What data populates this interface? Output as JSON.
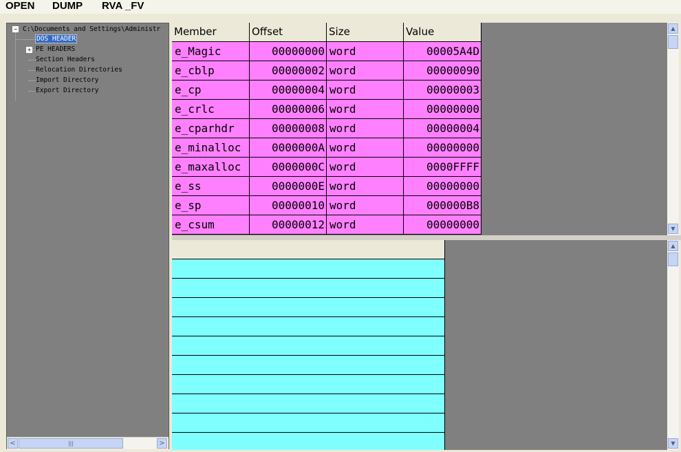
{
  "menu": [
    "OPEN",
    "DUMP",
    "RVA _FV"
  ],
  "tree": {
    "root": "C:\\Documents and Settings\\Administr",
    "root_expander": "−",
    "items": [
      {
        "label": "DOS HEADER",
        "selected": true,
        "expander": ""
      },
      {
        "label": "PE HEADERS",
        "selected": false,
        "expander": "+"
      },
      {
        "label": "Section Headers",
        "selected": false,
        "expander": ""
      },
      {
        "label": "Relocation Directories",
        "selected": false,
        "expander": ""
      },
      {
        "label": "Import Directory",
        "selected": false,
        "expander": ""
      },
      {
        "label": "Export Directory",
        "selected": false,
        "expander": ""
      }
    ]
  },
  "scroll_glyphs": {
    "left": "<",
    "right": ">",
    "up": "▲",
    "down": "▼",
    "grip": "|||"
  },
  "dos_table": {
    "columns": [
      "Member",
      "Offset",
      "Size",
      "Value"
    ],
    "rows": [
      [
        "e_Magic",
        "00000000",
        "word",
        "00005A4D"
      ],
      [
        "e_cblp",
        "00000002",
        "word",
        "00000090"
      ],
      [
        "e_cp",
        "00000004",
        "word",
        "00000003"
      ],
      [
        "e_crlc",
        "00000006",
        "word",
        "00000000"
      ],
      [
        "e_cparhdr",
        "00000008",
        "word",
        "00000004"
      ],
      [
        "e_minalloc",
        "0000000A",
        "word",
        "00000000"
      ],
      [
        "e_maxalloc",
        "0000000C",
        "word",
        "0000FFFF"
      ],
      [
        "e_ss",
        "0000000E",
        "word",
        "00000000"
      ],
      [
        "e_sp",
        "00000010",
        "word",
        "000000B8"
      ],
      [
        "e_csum",
        "00000012",
        "word",
        "00000000"
      ]
    ],
    "row_color": "#ff80ff"
  },
  "detail_table": {
    "header": "",
    "empty_rows": 10,
    "row_color": "#80ffff"
  }
}
